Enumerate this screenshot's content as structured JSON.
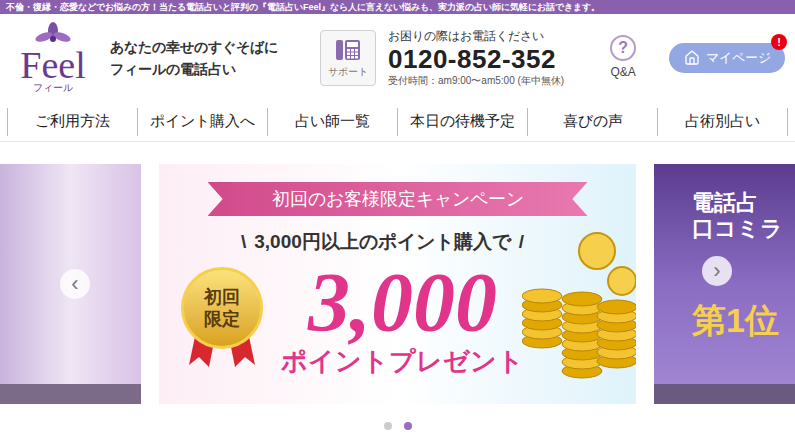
{
  "top_strip": "不倫・復縁・恋愛などでお悩みの方！当たる電話占いと評判の『電話占いFeel』なら人に言えない悩みも、実力派の占い師に気軽にお話できます。",
  "logo": {
    "name": "Feel",
    "kana": "フィール"
  },
  "tagline": [
    "あなたの幸せのすぐそばに",
    "フィールの電話占い"
  ],
  "support": {
    "label": "サポート"
  },
  "contact": {
    "prompt": "お困りの際はお電話ください",
    "phone": "0120-852-352",
    "hours": "受付時間：am9:00〜am5:00 (年中無休)"
  },
  "qa": {
    "icon": "?",
    "label": "Q&A"
  },
  "mypage": {
    "label": "マイページ",
    "badge": "!"
  },
  "nav": [
    "ご利用方法",
    "ポイント購入へ",
    "占い師一覧",
    "本日の待機予定",
    "喜びの声",
    "占術別占い"
  ],
  "carousel": {
    "prev": "‹",
    "next": "›",
    "center": {
      "ribbon": "初回のお客様限定キャンペーン",
      "slash_left": "\\",
      "condition": "3,000円以上のポイント購入で",
      "slash_right": "/",
      "medal": [
        "初回",
        "限定"
      ],
      "amount": "3,000",
      "suffix": "ポイントプレゼント"
    },
    "right_slide": {
      "lines": [
        "電話占",
        "口コミラ"
      ],
      "rank": "第1位"
    },
    "dots": [
      {
        "selected": false
      },
      {
        "selected": true
      }
    ]
  }
}
